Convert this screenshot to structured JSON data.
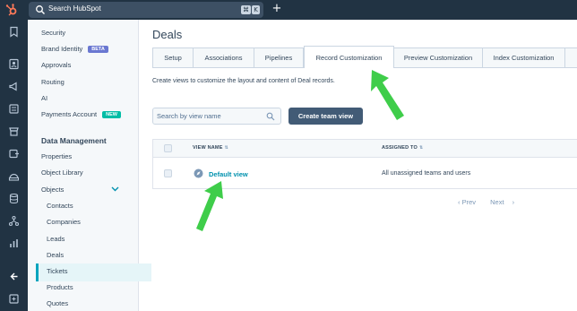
{
  "topbar": {
    "search_placeholder": "Search HubSpot",
    "shortcut_keys": [
      "⌘",
      "K"
    ],
    "add_label": "+"
  },
  "rail": {
    "icons": [
      "bookmark-icon",
      "contacts-icon",
      "marketing-icon",
      "content-icon",
      "commerce-icon",
      "automation-icon",
      "service-icon",
      "data-icon",
      "library-icon",
      "reporting-icon",
      "collapse-icon",
      "docs-icon"
    ]
  },
  "sidebar": {
    "items": [
      "Security",
      "Brand Identity",
      "Approvals",
      "Routing",
      "AI",
      "Payments Account"
    ],
    "badges": {
      "beta": "BETA",
      "new": "NEW"
    },
    "section_title": "Data Management",
    "data_items": [
      "Properties",
      "Object Library",
      "Objects"
    ],
    "object_items": [
      "Contacts",
      "Companies",
      "Leads",
      "Deals",
      "Tickets",
      "Products",
      "Quotes"
    ]
  },
  "main": {
    "title": "Deals",
    "tabs": [
      "Setup",
      "Associations",
      "Pipelines",
      "Record Customization",
      "Preview Customization",
      "Index Customization"
    ],
    "active_tab": "Record Customization",
    "description": "Create views to customize the layout and content of Deal records.",
    "search_placeholder": "Search by view name",
    "create_button": "Create team view",
    "columns": [
      "VIEW NAME",
      "ASSIGNED TO"
    ],
    "rows": [
      {
        "view_name": "Default view",
        "assigned_to": "All unassigned teams and users"
      }
    ],
    "pager": {
      "prev": "Prev",
      "next": "Next"
    }
  },
  "colors": {
    "nav_dark": "#213343",
    "accent_teal": "#00a4bd",
    "link_blue": "#0091ae",
    "button_slate": "#425b76",
    "annotation_green": "#3fcd4a"
  }
}
